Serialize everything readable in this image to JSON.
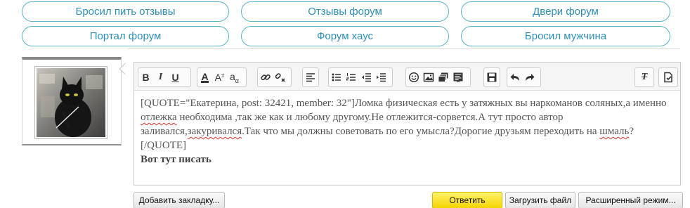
{
  "related_links": [
    {
      "label": "Бросил пить отзывы"
    },
    {
      "label": "Отзывы форум"
    },
    {
      "label": "Двери форум"
    },
    {
      "label": "Портал форум"
    },
    {
      "label": "Форум хаус"
    },
    {
      "label": "Бросил мужчина"
    }
  ],
  "toolbar": {
    "bold": "B",
    "italic": "I",
    "underline": "U",
    "font_color": "A",
    "font_size": "A",
    "font_family": "a",
    "font_size_sub": "±",
    "font_family_sub": "α",
    "remove_format": "T"
  },
  "editor": {
    "quote_open": "[QUOTE=\"Екатерина, post: 32421, member: 32\"]",
    "text_1": "Ломка физическая есть у затяжных вы наркоманов соляных,а именно ",
    "word_otlezhka": "отлежка",
    "text_2": " необходима ,так же как и любому другому.Не отлежится-сорвется.А тут просто автор заливался,",
    "word_zakurivalsya": "закуривался",
    "text_3": ".Так что мы должны советовать по его умысла?Дорогие друзьям переходить на ",
    "word_shmal": "шмаль",
    "quote_close": "?[/QUOTE]",
    "reply_text": "Вот тут писать"
  },
  "buttons": {
    "bookmark": "Добавить закладку...",
    "reply": "Ответить",
    "upload": "Загрузить файл",
    "advanced": "Расширенный режим..."
  },
  "colors": {
    "pill_border": "#5bb6cc",
    "pill_text": "#2f8fb4",
    "reply_button": "#f5d500"
  }
}
